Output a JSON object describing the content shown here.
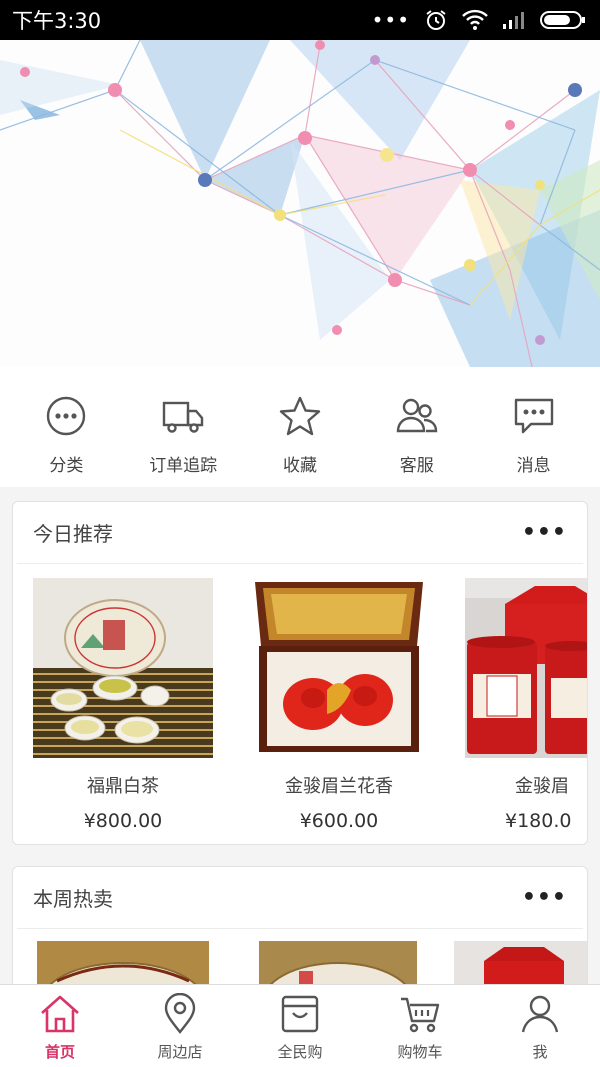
{
  "status_bar": {
    "time": "下午3:30"
  },
  "quick_menu": [
    {
      "label": "分类",
      "icon": "more-dots-circle-icon"
    },
    {
      "label": "订单追踪",
      "icon": "delivery-truck-icon"
    },
    {
      "label": "收藏",
      "icon": "star-icon"
    },
    {
      "label": "客服",
      "icon": "people-icon"
    },
    {
      "label": "消息",
      "icon": "chat-bubble-icon"
    }
  ],
  "sections": [
    {
      "title": "今日推荐",
      "more": "•••",
      "products": [
        {
          "name": "福鼎白茶",
          "price": "¥800.00"
        },
        {
          "name": "金骏眉兰花香",
          "price": "¥600.00"
        },
        {
          "name": "金骏眉",
          "price": "¥180.0"
        }
      ]
    },
    {
      "title": "本周热卖",
      "more": "•••"
    }
  ],
  "bottom_nav": [
    {
      "label": "首页",
      "icon": "home-icon",
      "active": true
    },
    {
      "label": "周边店",
      "icon": "location-pin-icon"
    },
    {
      "label": "全民购",
      "icon": "shopping-bag-icon"
    },
    {
      "label": "购物车",
      "icon": "cart-icon"
    },
    {
      "label": "我",
      "icon": "user-icon"
    }
  ],
  "colors": {
    "accent": "#d83467",
    "icon": "#555555"
  }
}
